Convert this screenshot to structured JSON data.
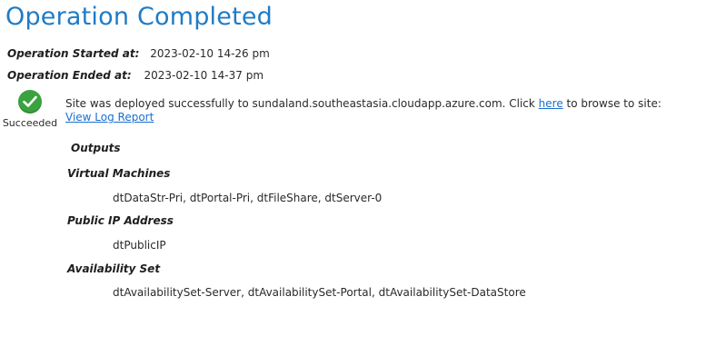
{
  "title": "Operation Completed",
  "started": {
    "label": "Operation Started at:",
    "value": "2023-02-10 14-26 pm"
  },
  "ended": {
    "label": "Operation Ended at:",
    "value": "2023-02-10 14-37 pm"
  },
  "status": {
    "icon": "checkmark-circle-icon",
    "color": "#3aa23e",
    "label": "Succeeded"
  },
  "message": {
    "prefix": "Site was deployed successfully to sundaland.southeastasia.cloudapp.azure.com.  Click ",
    "link_text": "here",
    "suffix": " to browse to site:",
    "log_link": "View Log Report"
  },
  "outputs": {
    "heading": "Outputs",
    "sections": [
      {
        "heading": "Virtual Machines",
        "value": "dtDataStr-Pri, dtPortal-Pri, dtFileShare, dtServer-0"
      },
      {
        "heading": "Public IP Address",
        "value": "dtPublicIP"
      },
      {
        "heading": "Availability Set",
        "value": "dtAvailabilitySet-Server, dtAvailabilitySet-Portal, dtAvailabilitySet-DataStore"
      }
    ]
  },
  "colors": {
    "title": "#1f7bc6",
    "link": "#1a6fd0"
  }
}
